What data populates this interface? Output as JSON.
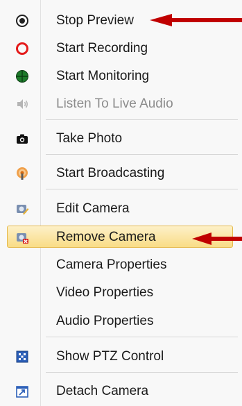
{
  "menu": {
    "items": [
      {
        "label": "Stop Preview",
        "icon": "stop-preview-icon"
      },
      {
        "label": "Start Recording",
        "icon": "record-ring-icon"
      },
      {
        "label": "Start Monitoring",
        "icon": "monitor-globe-icon"
      },
      {
        "label": "Listen To Live Audio",
        "icon": "speaker-icon"
      },
      {
        "label": "Take Photo",
        "icon": "camera-icon"
      },
      {
        "label": "Start Broadcasting",
        "icon": "broadcast-icon"
      },
      {
        "label": "Edit Camera",
        "icon": "edit-camera-icon"
      },
      {
        "label": "Remove Camera",
        "icon": "remove-camera-icon"
      },
      {
        "label": "Camera Properties"
      },
      {
        "label": "Video Properties"
      },
      {
        "label": "Audio Properties"
      },
      {
        "label": "Show PTZ Control",
        "icon": "ptz-grid-icon"
      },
      {
        "label": "Detach Camera",
        "icon": "detach-window-icon"
      }
    ]
  },
  "colors": {
    "highlight": "#f9dc86",
    "arrow": "#c00000",
    "disabled_text": "#8c8c8c"
  }
}
